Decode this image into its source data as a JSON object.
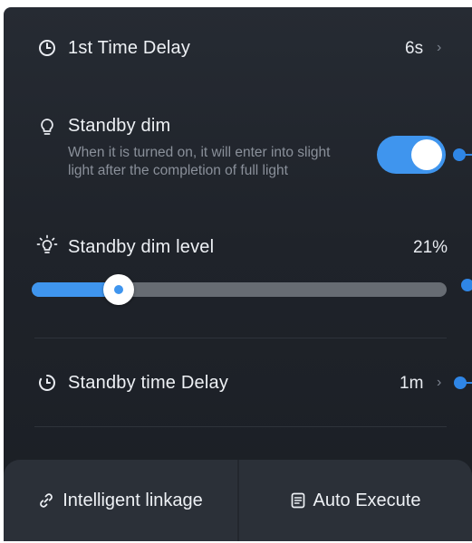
{
  "settings": {
    "first_delay": {
      "label": "1st Time Delay",
      "value": "6s",
      "icon": "clock-icon"
    },
    "standby_dim": {
      "label": "Standby dim",
      "description": "When it is turned on, it will enter into slight light after the completion of full light",
      "enabled": true,
      "icon": "lightbulb-icon"
    },
    "standby_dim_level": {
      "label": "Standby dim level",
      "value": "21%",
      "level_percent": 21,
      "icon": "bright-bulb-icon"
    },
    "standby_time_delay": {
      "label": "Standby time Delay",
      "value": "1m",
      "icon": "timer-icon"
    }
  },
  "bottom": {
    "linkage_label": "Intelligent linkage",
    "execute_label": "Auto Execute"
  },
  "colors": {
    "accent": "#3f95ee",
    "background": "#22262d",
    "track": "#676c73"
  }
}
